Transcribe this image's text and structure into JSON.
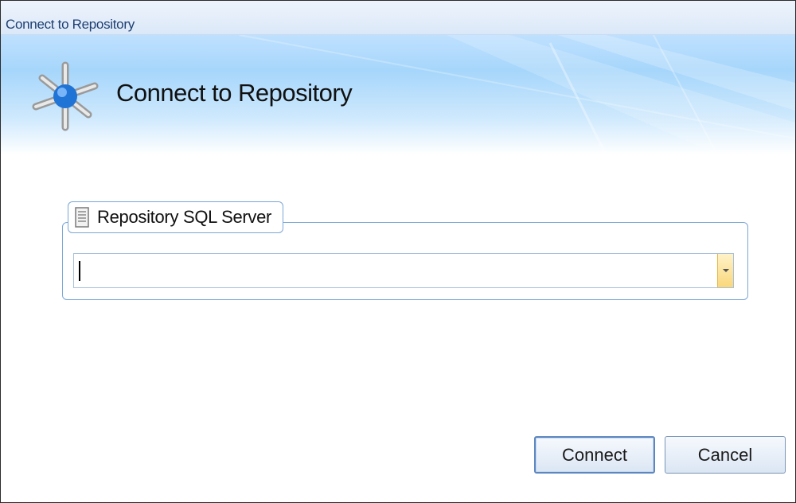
{
  "window": {
    "title": "Connect to Repository"
  },
  "header": {
    "title": "Connect to Repository",
    "icon": "network-hub-icon"
  },
  "server_group": {
    "caption": "Repository SQL Server",
    "icon": "server-icon",
    "input_value": ""
  },
  "buttons": {
    "connect_label": "Connect",
    "cancel_label": "Cancel"
  },
  "colors": {
    "accent": "#7aa7d6",
    "banner": "#a6d6fb",
    "dropdown_button": "#f9d77a"
  }
}
